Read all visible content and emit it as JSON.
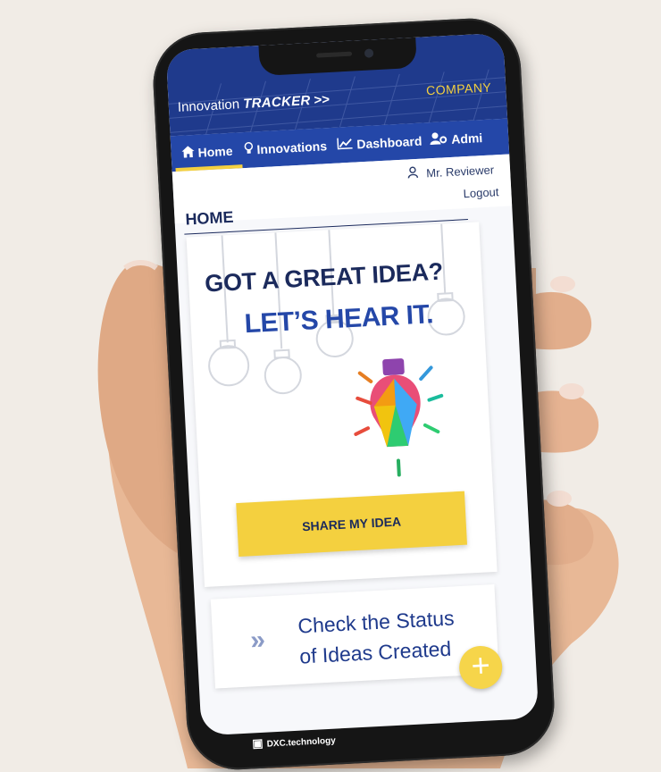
{
  "colors": {
    "primary": "#1f3a8c",
    "nav": "#2447a8",
    "accent_yellow": "#f4d03f",
    "title": "#1b2a5c"
  },
  "header": {
    "brand_prefix": "Innovation ",
    "brand_tracker": "TRACKER",
    "brand_chevron": ">>",
    "company": "COMPANY"
  },
  "nav": {
    "items": [
      {
        "label": "Home",
        "icon": "home-icon",
        "active": true
      },
      {
        "label": "Innovations",
        "icon": "lightbulb-icon",
        "active": false
      },
      {
        "label": "Dashboard",
        "icon": "chart-line-icon",
        "active": false
      },
      {
        "label": "Admi",
        "icon": "users-gear-icon",
        "active": false
      }
    ]
  },
  "user": {
    "name": "Mr. Reviewer",
    "logout": "Logout"
  },
  "page": {
    "title": "HOME"
  },
  "hero": {
    "headline": "GOT A GREAT IDEA?",
    "subheadline": "LET’S HEAR IT.",
    "button": "SHARE MY IDEA"
  },
  "status_card": {
    "chevron": "»",
    "line1": "Check the Status",
    "line2": "of Ideas Created"
  },
  "fab": {
    "label": "+"
  },
  "footer": {
    "logo_text": "DXC.technology"
  }
}
